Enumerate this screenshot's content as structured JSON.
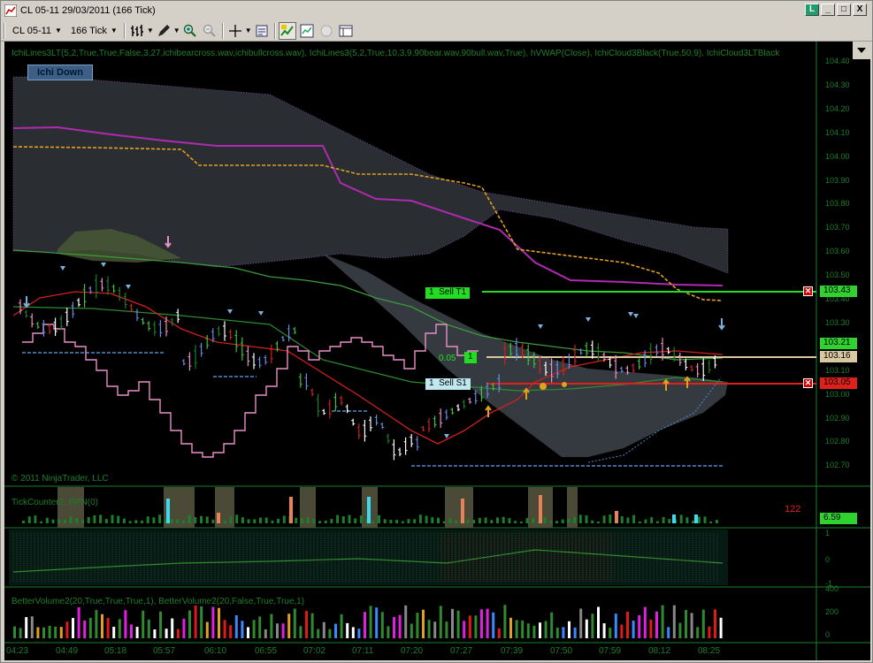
{
  "window": {
    "title": "CL 05-11  29/03/2011 (166 Tick)",
    "controls": [
      "_",
      "□",
      "X"
    ]
  },
  "toolbar": {
    "instrument": "CL 05-11",
    "interval": "166 Tick"
  },
  "chart": {
    "indicators_text": "IchiLines3LT(5,2,True,True,False,3,27,ichibearcross.wav,ichibullcross.wav), IchiLines3(5,2,True,10,3,9,90bear.wav,90bull.wav,True), hVWAP(Close), IchiCloud3Black(True,50,9), IchiCloud3LTBlack",
    "badge": "Ichi Down",
    "copyright": "© 2011 NinjaTrader, LLC",
    "y_axis_labels": [
      "104.40",
      "104.30",
      "104.20",
      "104.10",
      "104.00",
      "103.90",
      "103.80",
      "103.70",
      "103.60",
      "103.50",
      "103.40",
      "103.30",
      "103.20",
      "103.10",
      "103.00",
      "102.90",
      "102.80",
      "102.70"
    ],
    "price_tags": [
      {
        "value": "103.43",
        "color": "#2fd22f"
      },
      {
        "value": "103.21",
        "color": "#2fd22f"
      },
      {
        "value": "103.16",
        "color": "#d8c8a0"
      },
      {
        "value": "103.05",
        "color": "#e0201a"
      }
    ],
    "orders": [
      {
        "qty": "1",
        "label": "Sell T1",
        "color": "#22dd22"
      },
      {
        "qty": "1",
        "label": "",
        "color": "#22dd22",
        "prefix": "0.05"
      },
      {
        "qty": "1",
        "label": "Sell S1",
        "color": "#bfe8f0"
      }
    ],
    "close_icon": "close-x-icon"
  },
  "panels": {
    "tick_counter_label": "TickCounter2, RPN(0)",
    "tick_counter_value": "122",
    "tick_counter_tag": "6.59",
    "panel2_axis": [
      "1",
      "0",
      "-1"
    ],
    "better_volume_label": "BetterVolume2(20,True,True,True,1), BetterVolume2(20,False,True,True,1)",
    "volume_axis": [
      "400",
      "200",
      "0"
    ]
  },
  "x_axis_labels": [
    "04:23",
    "04:49",
    "05:18",
    "05:57",
    "06:10",
    "06:55",
    "07:02",
    "07:11",
    "07:20",
    "07:27",
    "07:39",
    "07:50",
    "07:59",
    "08:12",
    "08:25"
  ]
}
